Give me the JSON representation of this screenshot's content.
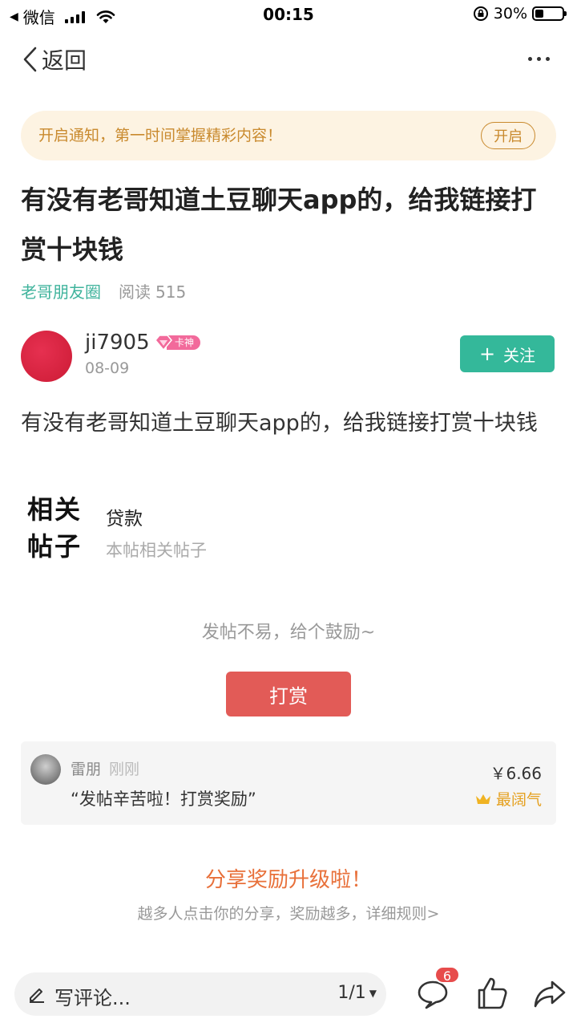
{
  "status_bar": {
    "back_app": "微信",
    "time": "00:15",
    "battery": "30%",
    "battery_level": 0.3
  },
  "nav": {
    "back_label": "返回",
    "more_icon": "more-icon"
  },
  "notify": {
    "text": "开启通知，第一时间掌握精彩内容！",
    "button": "开启"
  },
  "post": {
    "title": "有没有老哥知道土豆聊天app的，给我链接打赏十块钱",
    "circle": "老哥朋友圈",
    "read_label": "阅读",
    "read_count": "515",
    "body": "有没有老哥知道土豆聊天app的，给我链接打赏十块钱"
  },
  "author": {
    "name": "ji7905",
    "badge": "卡神",
    "date": "08-09",
    "follow_label": "关注",
    "follow_color": "#34b89a"
  },
  "related": {
    "label": "相关帖子",
    "item": "贷款",
    "subtitle": "本帖相关帖子"
  },
  "reward": {
    "encourage": "发帖不易，给个鼓励~",
    "button": "打赏",
    "button_color": "#e25b57",
    "card": {
      "name": "雷朋",
      "time": "刚刚",
      "message": "“发帖辛苦啦！打赏奖励”",
      "amount": "￥6.66",
      "rank": "最阔气"
    }
  },
  "share": {
    "title": "分享奖励升级啦！",
    "desc": "越多人点击你的分享，奖励越多，详细规则>"
  },
  "bottom_bar": {
    "comment_placeholder": "写评论...",
    "page": "1/1",
    "comment_count": "6",
    "icons": [
      "comment-icon",
      "like-icon",
      "share-icon"
    ]
  }
}
